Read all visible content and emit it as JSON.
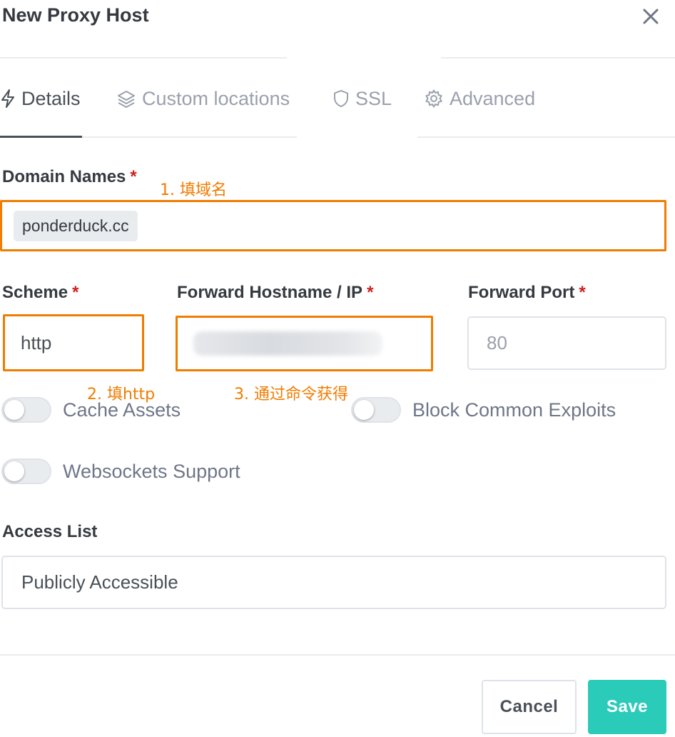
{
  "dialog": {
    "title": "New Proxy Host",
    "close_icon": "close-icon"
  },
  "tabs": [
    {
      "label": "Details",
      "icon": "bolt-icon",
      "active": true
    },
    {
      "label": "Custom locations",
      "icon": "layers-icon",
      "active": false
    },
    {
      "label": "SSL",
      "icon": "shield-icon",
      "active": false
    },
    {
      "label": "Advanced",
      "icon": "gear-icon",
      "active": false
    }
  ],
  "form": {
    "domain_names": {
      "label": "Domain Names",
      "required": "*",
      "value": "ponderduck.cc"
    },
    "scheme": {
      "label": "Scheme",
      "required": "*",
      "value": "http"
    },
    "forward_hostname": {
      "label": "Forward Hostname / IP",
      "required": "*",
      "value": ""
    },
    "forward_port": {
      "label": "Forward Port",
      "required": "*",
      "placeholder": "80"
    },
    "cache_assets": {
      "label": "Cache Assets",
      "enabled": false
    },
    "block_common_exploits": {
      "label": "Block Common Exploits",
      "enabled": false
    },
    "websockets_support": {
      "label": "Websockets Support",
      "enabled": false
    },
    "access_list": {
      "label": "Access List",
      "value": "Publicly Accessible"
    }
  },
  "annotations": {
    "step1": "1. 填域名",
    "step2": "2. 填http",
    "step3": "3. 通过命令获得"
  },
  "footer": {
    "cancel_label": "Cancel",
    "save_label": "Save"
  },
  "colors": {
    "annotation": "#f07c00",
    "save_button": "#2bcbba",
    "required": "#cd201f"
  }
}
